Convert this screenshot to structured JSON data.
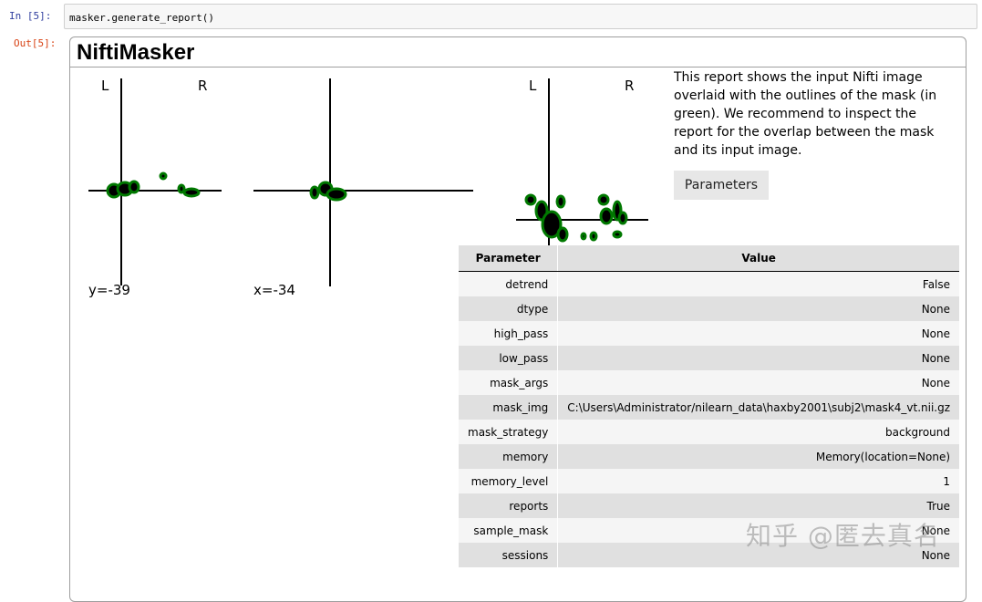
{
  "notebook": {
    "in_prompt": "In  [5]:",
    "out_prompt": "Out[5]:",
    "code": "masker.generate_report()"
  },
  "report": {
    "title": "NiftiMasker",
    "description": "This report shows the input Nifti image overlaid with the outlines of the mask (in green). We recommend to inspect the report for the overlap between the mask and its input image.",
    "parameters_button": "Parameters",
    "figure": {
      "left_label": "L",
      "right_label": "R",
      "coronal_cut": "y=-39",
      "sagittal_cut": "x=-34",
      "axial_left_label": "L",
      "axial_right_label": "R",
      "mask_color": "#007800"
    },
    "table": {
      "headers": [
        "Parameter",
        "Value"
      ],
      "rows": [
        {
          "param": "detrend",
          "value": "False"
        },
        {
          "param": "dtype",
          "value": "None"
        },
        {
          "param": "high_pass",
          "value": "None"
        },
        {
          "param": "low_pass",
          "value": "None"
        },
        {
          "param": "mask_args",
          "value": "None"
        },
        {
          "param": "mask_img",
          "value": "C:\\Users\\Administrator/nilearn_data\\haxby2001\\subj2\\mask4_vt.nii.gz"
        },
        {
          "param": "mask_strategy",
          "value": "background"
        },
        {
          "param": "memory",
          "value": "Memory(location=None)"
        },
        {
          "param": "memory_level",
          "value": "1"
        },
        {
          "param": "reports",
          "value": "True"
        },
        {
          "param": "sample_mask",
          "value": "None"
        },
        {
          "param": "sessions",
          "value": "None"
        }
      ]
    }
  },
  "watermark": "知乎 @匿去真名"
}
